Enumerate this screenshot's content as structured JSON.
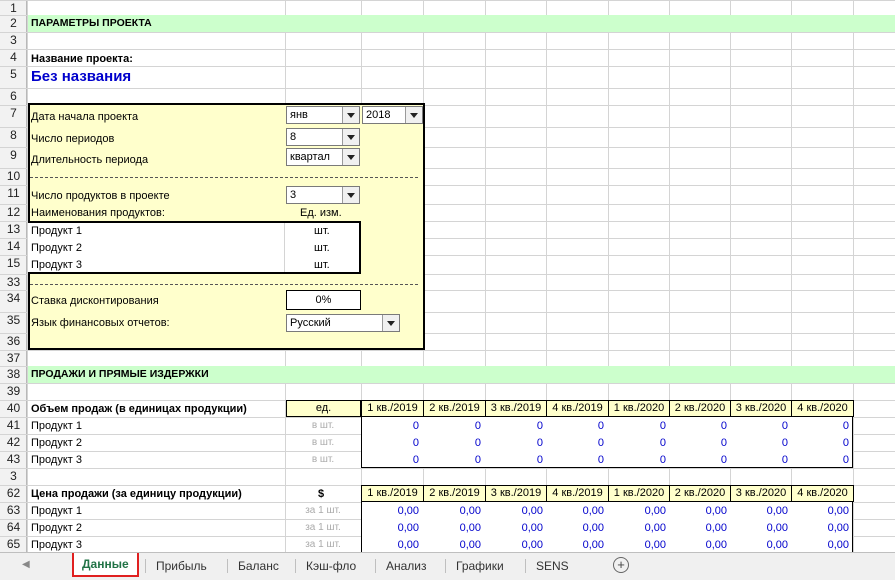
{
  "section_params": "ПАРАМЕТРЫ ПРОЕКТА",
  "project_name_label": "Название проекта:",
  "project_name_value": "Без названия",
  "start_date": {
    "label": "Дата начала проекта",
    "month": "янв",
    "year": "2018"
  },
  "periods": {
    "label": "Число периодов",
    "value": "8"
  },
  "period_length": {
    "label": "Длительность периода",
    "value": "квартал"
  },
  "products_count": {
    "label": "Число продуктов в проекте",
    "value": "3"
  },
  "product_names_label": "Наименования продуктов:",
  "unit_header": "Ед. изм.",
  "products": [
    {
      "name": "Продукт 1",
      "unit": "шт."
    },
    {
      "name": "Продукт 2",
      "unit": "шт."
    },
    {
      "name": "Продукт 3",
      "unit": "шт."
    }
  ],
  "discount": {
    "label": "Ставка дисконтирования",
    "value": "0%"
  },
  "report_lang": {
    "label": "Язык финансовых отчетов:",
    "value": "Русский"
  },
  "section_sales": "ПРОДАЖИ И ПРЯМЫЕ ИЗДЕРЖКИ",
  "quarters": [
    "1 кв./2019",
    "2 кв./2019",
    "3 кв./2019",
    "4 кв./2019",
    "1 кв./2020",
    "2 кв./2020",
    "3 кв./2020",
    "4 кв./2020"
  ],
  "volume": {
    "label": "Объем продаж (в единицах продукции)",
    "unit": "ед.",
    "rows": [
      {
        "name": "Продукт 1",
        "unit": "в шт.",
        "values": [
          "0",
          "0",
          "0",
          "0",
          "0",
          "0",
          "0",
          "0"
        ]
      },
      {
        "name": "Продукт 2",
        "unit": "в шт.",
        "values": [
          "0",
          "0",
          "0",
          "0",
          "0",
          "0",
          "0",
          "0"
        ]
      },
      {
        "name": "Продукт 3",
        "unit": "в шт.",
        "values": [
          "0",
          "0",
          "0",
          "0",
          "0",
          "0",
          "0",
          "0"
        ]
      }
    ]
  },
  "price": {
    "label": "Цена продажи (за единицу продукции)",
    "unit": "$",
    "rows": [
      {
        "name": "Продукт 1",
        "unit": "за 1 шт.",
        "values": [
          "0,00",
          "0,00",
          "0,00",
          "0,00",
          "0,00",
          "0,00",
          "0,00",
          "0,00"
        ]
      },
      {
        "name": "Продукт 2",
        "unit": "за 1 шт.",
        "values": [
          "0,00",
          "0,00",
          "0,00",
          "0,00",
          "0,00",
          "0,00",
          "0,00",
          "0,00"
        ]
      },
      {
        "name": "Продукт 3",
        "unit": "за 1 шт.",
        "values": [
          "0,00",
          "0,00",
          "0,00",
          "0,00",
          "0,00",
          "0,00",
          "0,00",
          "0,00"
        ]
      }
    ]
  },
  "row_numbers": [
    "1",
    "2",
    "3",
    "4",
    "5",
    "6",
    "7",
    "8",
    "9",
    "10",
    "11",
    "12",
    "13",
    "14",
    "15",
    "33",
    "34",
    "35",
    "36",
    "37",
    "38",
    "39",
    "40",
    "41",
    "42",
    "43",
    "3",
    "62",
    "63",
    "64",
    "65"
  ],
  "sheet_tabs": [
    "Данные",
    "Прибыль",
    "Баланс",
    "Кэш-фло",
    "Анализ",
    "Графики",
    "SENS"
  ],
  "active_tab": "Данные"
}
